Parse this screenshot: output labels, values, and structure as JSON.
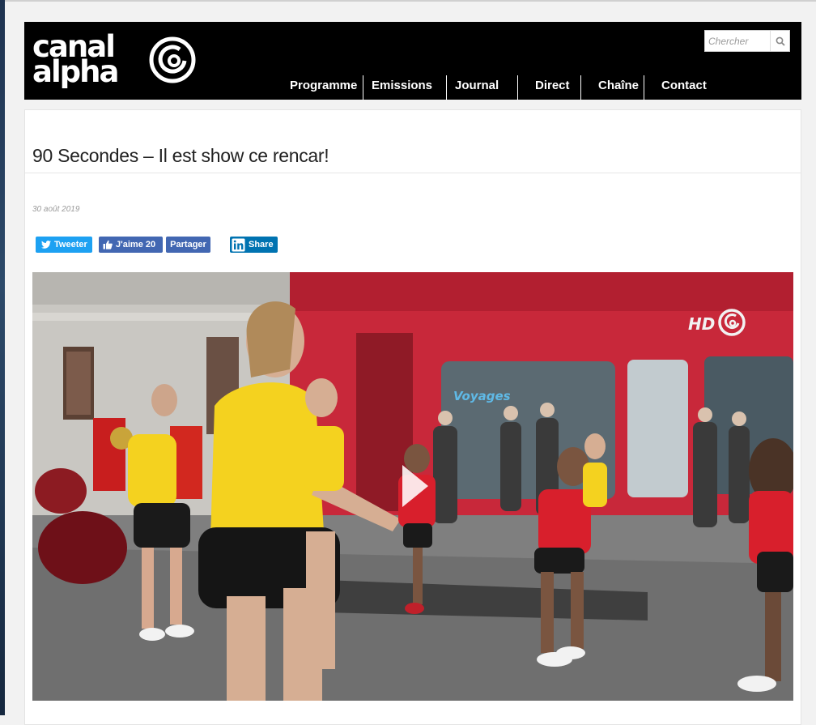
{
  "header": {
    "logo": {
      "line1": "canal",
      "line2": "alpha"
    },
    "search": {
      "placeholder": "Chercher"
    },
    "nav": [
      "Programme",
      "Emissions",
      "Journal",
      "Direct",
      "Chaîne",
      "Contact"
    ]
  },
  "article": {
    "title": "90 Secondes – Il est show ce rencar!",
    "date": "30 août 2019",
    "share": {
      "tweet": "Tweeter",
      "like": "J'aime 20",
      "fb_share": "Partager",
      "linkedin": "Share"
    },
    "video": {
      "badge": "HD",
      "sign": "Voyages"
    }
  },
  "colors": {
    "header_bg": "#000000",
    "twitter": "#1da1f2",
    "facebook": "#4267b2",
    "linkedin": "#0073b1",
    "storefront_red": "#c8283a",
    "shirt_yellow": "#f4d21f",
    "shirt_red": "#d81f2c"
  }
}
